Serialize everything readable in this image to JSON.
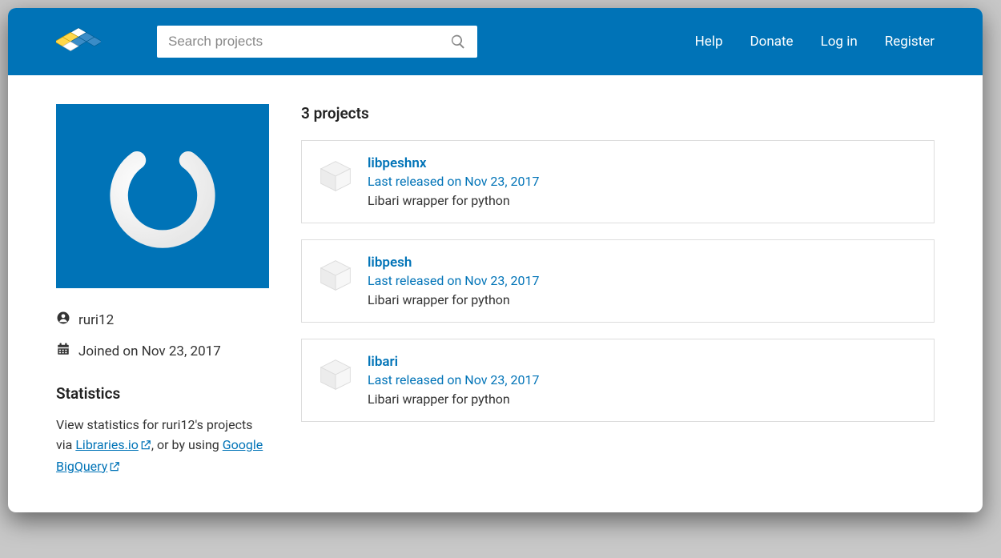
{
  "header": {
    "search_placeholder": "Search projects",
    "nav": {
      "help": "Help",
      "donate": "Donate",
      "login": "Log in",
      "register": "Register"
    }
  },
  "sidebar": {
    "username": "ruri12",
    "joined": "Joined on Nov 23, 2017",
    "stats_heading": "Statistics",
    "stats_pre": "View statistics for ruri12's projects via ",
    "stats_lib": "Libraries.io",
    "stats_mid": ", or by using ",
    "stats_bq": "Google BigQuery"
  },
  "main": {
    "projects_heading": "3 projects",
    "projects": [
      {
        "name": "libpeshnx",
        "released": "Last released on Nov 23, 2017",
        "desc": "Libari wrapper for python"
      },
      {
        "name": "libpesh",
        "released": "Last released on Nov 23, 2017",
        "desc": "Libari wrapper for python"
      },
      {
        "name": "libari",
        "released": "Last released on Nov 23, 2017",
        "desc": "Libari wrapper for python"
      }
    ]
  }
}
